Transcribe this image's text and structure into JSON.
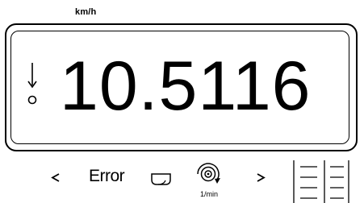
{
  "display": {
    "unit": "km/h",
    "value": "10.5116"
  },
  "softkeys": {
    "error_label": "Error",
    "rpm_unit": "1/min",
    "icons": [
      "chevron-left-icon",
      "tray-icon",
      "rotation-sensor-icon",
      "chevron-right-icon",
      "menu-lines-icon"
    ]
  },
  "colors": {
    "foreground": "#000000",
    "background": "#ffffff"
  }
}
